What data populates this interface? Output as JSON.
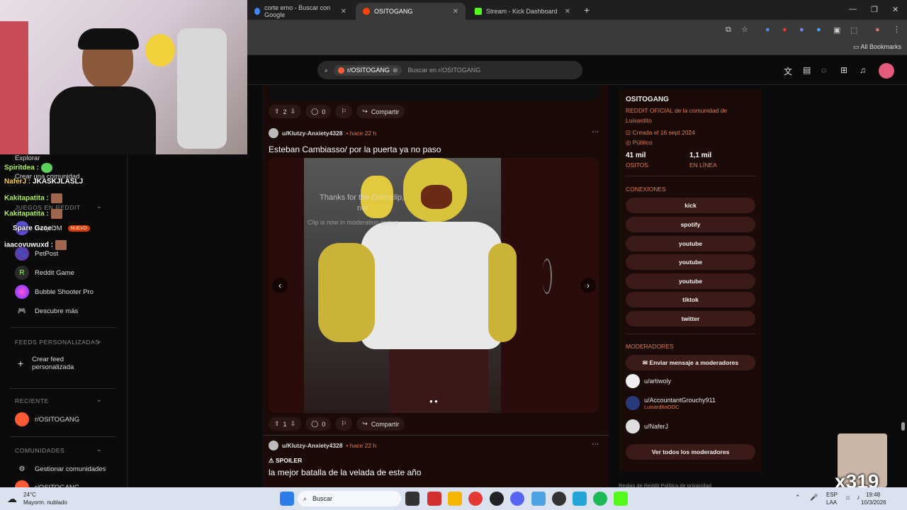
{
  "browser": {
    "tabs": [
      {
        "label": "corte emo - Buscar con Google"
      },
      {
        "label": "OSITOGANG"
      },
      {
        "label": "Stream - Kick Dashboard"
      }
    ],
    "new_tab": "+",
    "bookmarks_label": "All Bookmarks"
  },
  "reddit": {
    "search": {
      "chip": "r/OSITOGANG",
      "placeholder": "Buscar en r/OSITOGANG"
    }
  },
  "left_nav": {
    "explore": "Explorar",
    "create_community": "Crear una comunidad",
    "games_section": "JUEGOS EN REDDIT",
    "daily_badge": "NUEVO",
    "games": [
      {
        "label": "Daily DM"
      },
      {
        "label": "PetPost"
      },
      {
        "label": "Reddit Game"
      },
      {
        "label": "Bubble Shooter Pro"
      },
      {
        "label": "Descubre más"
      }
    ],
    "feeds_section": "FEEDS PERSONALIZADAS",
    "create_feed": "Crear feed personalizada",
    "recent_section": "RECIENTE",
    "recent_item": "r/OSITOGANG",
    "communities_section": "COMUNIDADES",
    "manage": "Gestionar comunidades",
    "community_item": "r/OSITOGANG"
  },
  "chat": [
    {
      "user": "Spiritdea :",
      "text": ""
    },
    {
      "user": "NaferJ :",
      "text": "JKASKJLASLJ"
    },
    {
      "user": "Kakitapatita :",
      "text": ""
    },
    {
      "user": "Kakitapatita :",
      "text": ""
    },
    {
      "user": "Spare Gzoe :",
      "text": ""
    },
    {
      "user": "iaacovuwuxd :",
      "text": ""
    }
  ],
  "feed": {
    "post0": {
      "votes": "2",
      "comments": "0",
      "share": "Compartir"
    },
    "post1": {
      "author": "u/Klutzy-Anxiety4328",
      "time": "• hace 22 h",
      "title": "Esteban Cambiasso/ por la puerta ya no paso",
      "video_caption_1": "Thanks for the Donoclip,",
      "video_caption_2": "no!",
      "video_caption_3": "Clip is now in moderation queue",
      "votes": "1",
      "comments": "0",
      "share": "Compartir"
    },
    "post2": {
      "author": "u/Klutzy-Anxiety4328",
      "time": "• hace 22 h",
      "tag": "SPOILER",
      "title": "la mejor batalla de la velada de este año"
    }
  },
  "sidebar": {
    "name": "OSITOGANG",
    "desc": "REDDIT OFICIAL de la comunidad de Luisardito",
    "created": "Creada el 16 sept 2024",
    "public": "Público",
    "members": "41 mil",
    "members_label": "OSITOS",
    "online": "1,1 mil",
    "online_label": "EN LÍNEA",
    "connections_title": "CONEXIONES",
    "connections": [
      "kick",
      "spotify",
      "youtube",
      "youtube",
      "youtube",
      "tiktok",
      "twitter"
    ],
    "mods_title": "MODERADORES",
    "message_mods": "Enviar mensaje a moderadores",
    "mods": [
      {
        "name": "u/artiwoly",
        "flair": ""
      },
      {
        "name": "u/AccountantGrouchy911",
        "flair": "LuisarditoOOC"
      },
      {
        "name": "u/NaferJ",
        "flair": ""
      }
    ],
    "view_all": "Ver todos los moderadores",
    "footer": "Reglas de Reddit  Política de privacidad"
  },
  "overlay": {
    "counter": "x319"
  },
  "taskbar": {
    "weather_temp": "24°C",
    "weather_desc": "Mayorm. nublado",
    "search": "Buscar",
    "lang": "ESP",
    "lang2": "LAA",
    "time": "19:48",
    "date": "10/3/2026"
  }
}
